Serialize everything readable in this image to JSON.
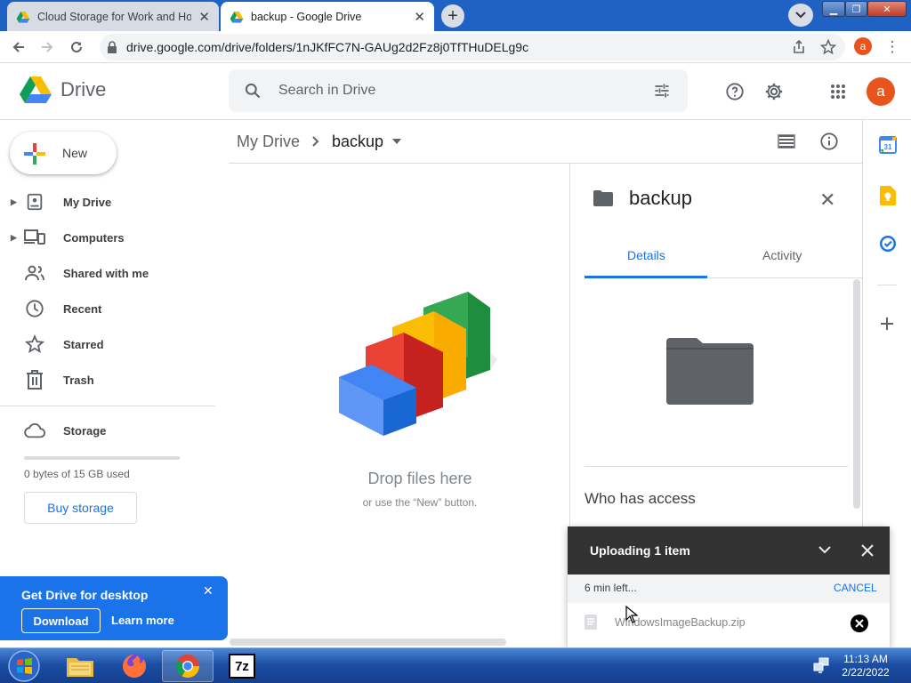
{
  "browser": {
    "tabs": [
      {
        "title": "Cloud Storage for Work and Home - Google Drive"
      },
      {
        "title": "backup - Google Drive"
      }
    ],
    "url": "drive.google.com/drive/folders/1nJKfFC7N-GAUg2d2Fz8j0TfTHuDELg9c",
    "profile_letter": "a"
  },
  "app": {
    "name": "Drive",
    "search_placeholder": "Search in Drive",
    "avatar_letter": "a"
  },
  "sidebar": {
    "new_label": "New",
    "items": [
      {
        "label": "My Drive",
        "icon": "my-drive-icon",
        "expandable": true
      },
      {
        "label": "Computers",
        "icon": "computers-icon",
        "expandable": true
      },
      {
        "label": "Shared with me",
        "icon": "shared-icon",
        "expandable": false
      },
      {
        "label": "Recent",
        "icon": "clock-icon",
        "expandable": false
      },
      {
        "label": "Starred",
        "icon": "star-icon",
        "expandable": false
      },
      {
        "label": "Trash",
        "icon": "trash-icon",
        "expandable": false
      }
    ],
    "storage_label": "Storage",
    "storage_used": "0 bytes of 15 GB used",
    "storage_fraction": 0,
    "buy_storage": "Buy storage",
    "promo": {
      "title": "Get Drive for desktop",
      "download": "Download",
      "learn_more": "Learn more"
    }
  },
  "main": {
    "breadcrumb": [
      "My Drive",
      "backup"
    ],
    "drop_title": "Drop files here",
    "drop_hint": "or use the “New” button."
  },
  "details": {
    "title": "backup",
    "tabs": [
      "Details",
      "Activity"
    ],
    "active_tab": "Details",
    "who_has_access": "Who has access"
  },
  "upload": {
    "title": "Uploading 1 item",
    "eta": "6 min left...",
    "cancel": "CANCEL",
    "file": "WindowsImageBackup.zip"
  },
  "taskbar": {
    "time": "11:13 AM",
    "date": "2/22/2022"
  },
  "colors": {
    "accent": "#1a73e8",
    "avatar": "#e8541c",
    "tabstrip": "#1f62c4"
  }
}
